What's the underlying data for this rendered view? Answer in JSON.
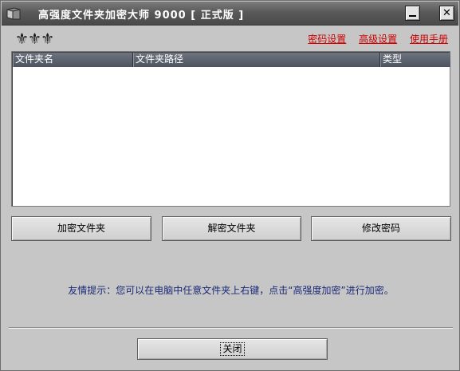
{
  "window": {
    "title": "高强度文件夹加密大师 9000 [ 正式版 ]"
  },
  "logo": {
    "text": "⚜⚜⚜"
  },
  "top_links": [
    {
      "label": "密码设置"
    },
    {
      "label": "高级设置"
    },
    {
      "label": "使用手册"
    }
  ],
  "list": {
    "columns": [
      {
        "label": "文件夹名"
      },
      {
        "label": "文件夹路径"
      },
      {
        "label": "类型"
      }
    ],
    "rows": []
  },
  "actions": {
    "encrypt_label": "加密文件夹",
    "decrypt_label": "解密文件夹",
    "change_password_label": "修改密码"
  },
  "tip": "友情提示：您可以在电脑中任意文件夹上右键，点击“高强度加密”进行加密。",
  "footer": {
    "close_label": "关闭"
  },
  "colors": {
    "title_bar": "#5a5a5a",
    "link": "#d00000",
    "tip_text": "#1b2a78",
    "list_header": "#565d69"
  }
}
